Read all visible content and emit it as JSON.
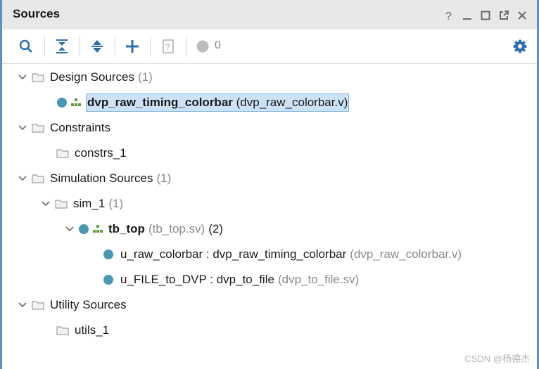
{
  "panel": {
    "title": "Sources",
    "controls": [
      "help-icon",
      "minimize-icon",
      "maximize-icon",
      "float-icon",
      "close-icon"
    ]
  },
  "toolbar": {
    "icons": [
      "search-icon",
      "collapse-all-icon",
      "expand-all-icon",
      "add-icon",
      "unknown-file-icon",
      "status-circle-icon"
    ],
    "count": "0",
    "settings_icon": "gear-icon"
  },
  "tree": {
    "design_sources": {
      "label": "Design Sources",
      "count": "(1)"
    },
    "design_top": {
      "name": "dvp_raw_timing_colorbar",
      "file": "(dvp_raw_colorbar.v)"
    },
    "constraints": {
      "label": "Constraints"
    },
    "constrs_1": {
      "label": "constrs_1"
    },
    "simulation_sources": {
      "label": "Simulation Sources",
      "count": "(1)"
    },
    "sim_1": {
      "label": "sim_1",
      "count": "(1)"
    },
    "tb_top": {
      "name": "tb_top",
      "file": "(tb_top.sv)",
      "count": "(2)"
    },
    "u_raw_colorbar": {
      "label": "u_raw_colorbar : dvp_raw_timing_colorbar",
      "file": "(dvp_raw_colorbar.v)"
    },
    "u_file_to_dvp": {
      "label": "u_FILE_to_DVP : dvp_to_file",
      "file": "(dvp_to_file.sv)"
    },
    "utility_sources": {
      "label": "Utility Sources"
    },
    "utils_1": {
      "label": "utils_1"
    }
  },
  "watermark": "CSDN @杨德杰",
  "colors": {
    "accent_border": "#5b8fd0",
    "status_dot": "#4a97b3",
    "selection": "#cce3f7",
    "toolbar_icon": "#2f6ea8"
  }
}
